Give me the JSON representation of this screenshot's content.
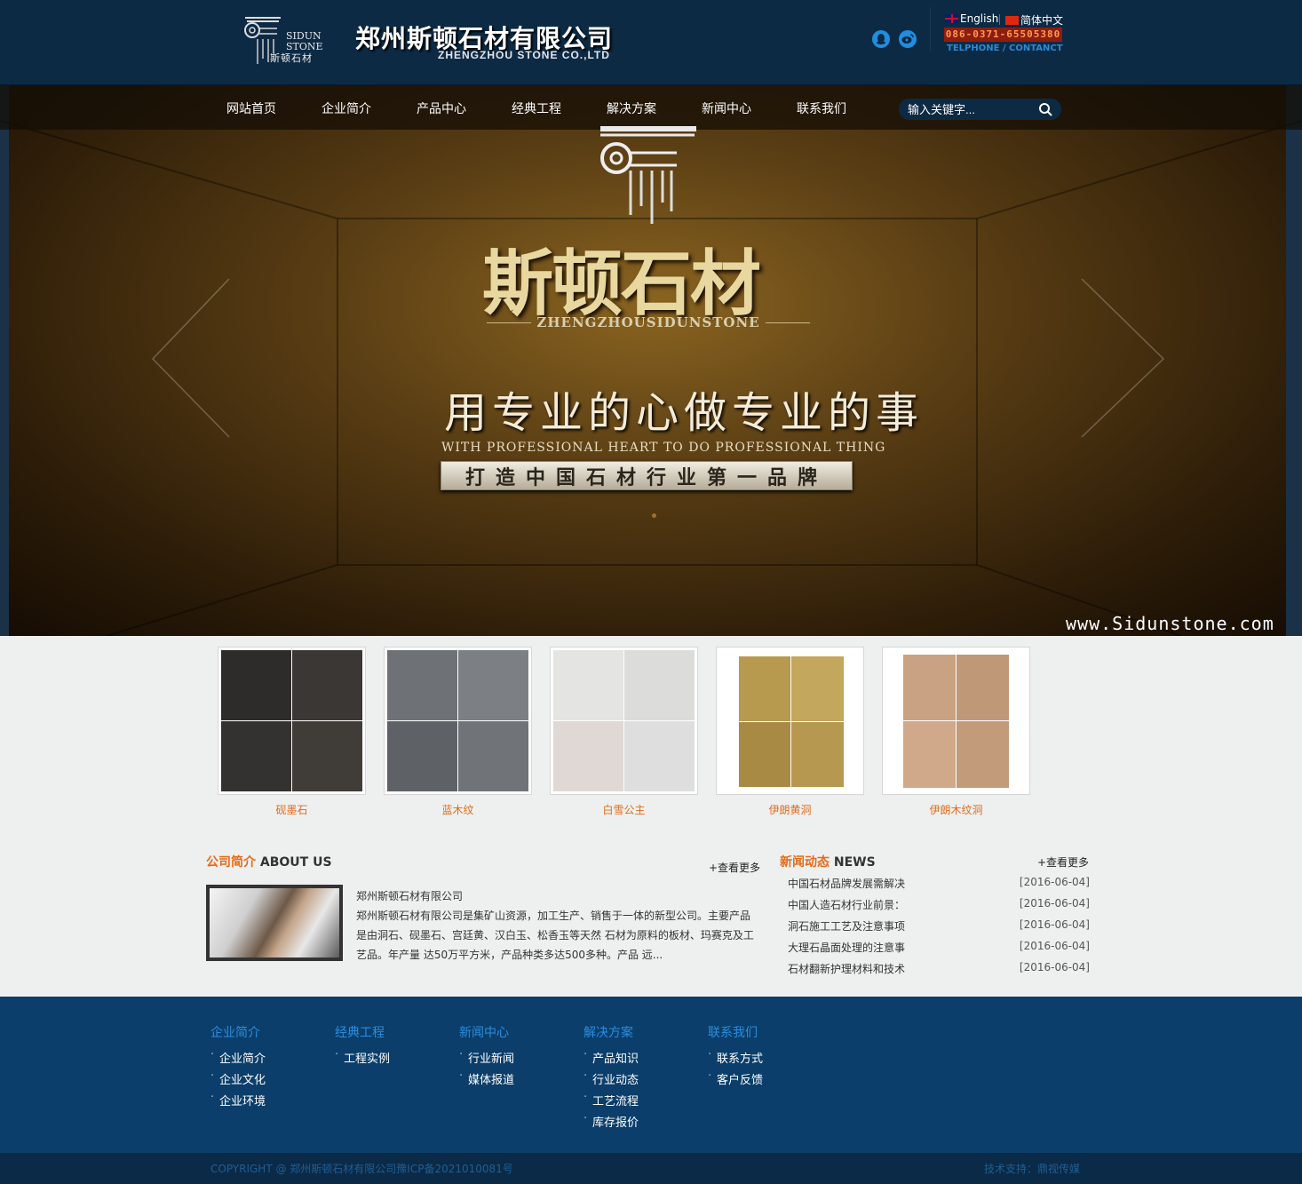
{
  "header": {
    "logo": {
      "line1": "SIDUN",
      "line2": "STONE",
      "line3": "斯顿石材"
    },
    "company_name": "郑州斯顿石材有限公司",
    "company_en": "ZHENGZHOU STONE CO.,LTD",
    "lang_en": "English",
    "lang_cn": "简体中文",
    "phone": "086-0371-65505380",
    "contact_label": "TELPHONE / CONTANCT"
  },
  "nav": {
    "items": [
      "网站首页",
      "企业简介",
      "产品中心",
      "经典工程",
      "解决方案",
      "新闻中心",
      "联系我们"
    ],
    "search_placeholder": "输入关键字..."
  },
  "banner": {
    "title": "斯顿石材",
    "subtitle_en": "ZHENGZHOUSIDUNSTONE",
    "slogan": "用专业的心做专业的事",
    "slogan_en": "WITH PROFESSIONAL HEART TO DO PROFESSIONAL THING",
    "plate": "打造中国石材行业第一品牌",
    "watermark": "www.Sidunstone.com"
  },
  "products": [
    {
      "name": "砚墨石",
      "colors": [
        "#2e2c2a",
        "#3a3734",
        "#343230",
        "#403c38"
      ]
    },
    {
      "name": "蓝木纹",
      "colors": [
        "#6e7276",
        "#7c8084",
        "#5e6266",
        "#707478"
      ]
    },
    {
      "name": "白雪公主",
      "colors": [
        "#e4e4e2",
        "#dcdcda",
        "#e0d8d4",
        "#dedede"
      ]
    },
    {
      "name": "伊朗黄洞",
      "colors": [
        "#b89a4e",
        "#c2a75c",
        "#a88a44",
        "#b69850"
      ]
    },
    {
      "name": "伊朗木纹洞",
      "colors": [
        "#c9a283",
        "#bf9878",
        "#cfa989",
        "#c29b7b"
      ]
    }
  ],
  "about": {
    "title_cn": "公司简介",
    "title_en": "ABOUT US",
    "more": "+查看更多",
    "name": "郑州斯顿石材有限公司",
    "text": "郑州斯顿石材有限公司是集矿山资源，加工生产、销售于一体的新型公司。主要产品是由洞石、砚墨石、宫廷黄、汉白玉、松香玉等天然 石材为原料的板材、玛赛克及工艺品。年产量 达50万平方米，产品种类多达500多种。产品 远..."
  },
  "news": {
    "title_cn": "新闻动态",
    "title_en": "NEWS",
    "more": "+查看更多",
    "items": [
      {
        "title": "中国石材品牌发展需解决",
        "date": "[2016-06-04]"
      },
      {
        "title": "中国人造石材行业前景：",
        "date": "[2016-06-04]"
      },
      {
        "title": "洞石施工工艺及注意事项",
        "date": "[2016-06-04]"
      },
      {
        "title": "大理石晶面处理的注意事",
        "date": "[2016-06-04]"
      },
      {
        "title": "石材翻新护理材料和技术",
        "date": "[2016-06-04]"
      }
    ]
  },
  "footer": {
    "columns": [
      {
        "title": "企业简介",
        "items": [
          "企业简介",
          "企业文化",
          "企业环境"
        ]
      },
      {
        "title": "经典工程",
        "items": [
          "工程实例"
        ]
      },
      {
        "title": "新闻中心",
        "items": [
          "行业新闻",
          "媒体报道"
        ]
      },
      {
        "title": "解决方案",
        "items": [
          "产品知识",
          "行业动态",
          "工艺流程",
          "库存报价"
        ]
      },
      {
        "title": "联系我们",
        "items": [
          "联系方式",
          "客户反馈"
        ]
      }
    ],
    "copyright": "COPYRIGHT @ 郑州斯顿石材有限公司豫ICP备2021010081号",
    "tech_support": "技术支持：鼎视传媒"
  },
  "colors": {
    "header_bg": "#0d2a44",
    "accent_orange": "#e36b1a",
    "footer_bg": "#0b3e6a",
    "link_blue": "#2a8ee0"
  }
}
